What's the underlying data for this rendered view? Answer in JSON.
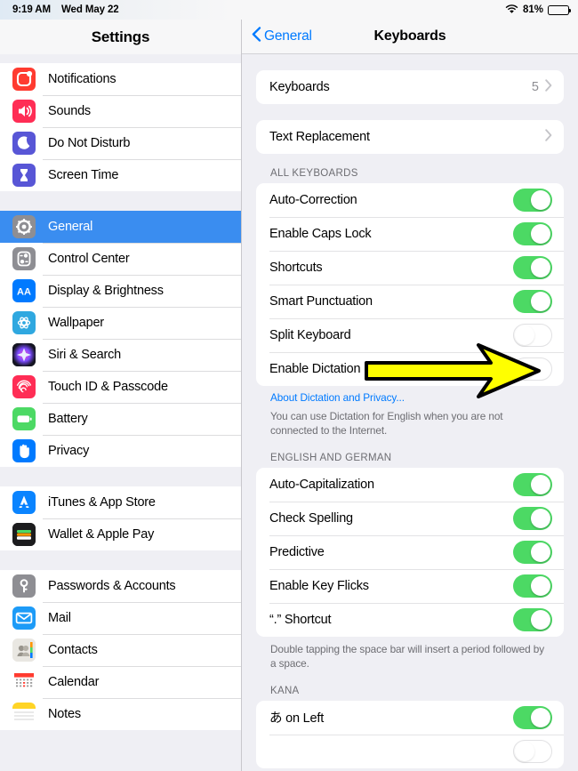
{
  "status_bar": {
    "time": "9:19 AM",
    "date": "Wed May 22",
    "battery_percent": "81%",
    "wifi_icon": "wifi-icon",
    "battery_icon": "battery-icon"
  },
  "sidebar": {
    "title": "Settings",
    "groups": [
      {
        "items": [
          {
            "label": "Notifications",
            "icon": "notifications-icon",
            "selected": false
          },
          {
            "label": "Sounds",
            "icon": "sounds-icon",
            "selected": false
          },
          {
            "label": "Do Not Disturb",
            "icon": "moon-icon",
            "selected": false
          },
          {
            "label": "Screen Time",
            "icon": "hourglass-icon",
            "selected": false
          }
        ]
      },
      {
        "items": [
          {
            "label": "General",
            "icon": "gear-icon",
            "selected": true
          },
          {
            "label": "Control Center",
            "icon": "control-center-icon",
            "selected": false
          },
          {
            "label": "Display & Brightness",
            "icon": "display-brightness-icon",
            "selected": false
          },
          {
            "label": "Wallpaper",
            "icon": "wallpaper-icon",
            "selected": false
          },
          {
            "label": "Siri & Search",
            "icon": "siri-icon",
            "selected": false
          },
          {
            "label": "Touch ID & Passcode",
            "icon": "fingerprint-icon",
            "selected": false
          },
          {
            "label": "Battery",
            "icon": "battery-icon",
            "selected": false
          },
          {
            "label": "Privacy",
            "icon": "hand-icon",
            "selected": false
          }
        ]
      },
      {
        "items": [
          {
            "label": "iTunes & App Store",
            "icon": "app-store-icon",
            "selected": false
          },
          {
            "label": "Wallet & Apple Pay",
            "icon": "wallet-icon",
            "selected": false
          }
        ]
      },
      {
        "items": [
          {
            "label": "Passwords & Accounts",
            "icon": "key-icon",
            "selected": false
          },
          {
            "label": "Mail",
            "icon": "mail-icon",
            "selected": false
          },
          {
            "label": "Contacts",
            "icon": "contacts-icon",
            "selected": false
          },
          {
            "label": "Calendar",
            "icon": "calendar-icon",
            "selected": false
          },
          {
            "label": "Notes",
            "icon": "notes-icon",
            "selected": false
          }
        ]
      }
    ]
  },
  "nav": {
    "back_label": "General",
    "back_icon": "chevron-left-icon",
    "title": "Keyboards"
  },
  "detail": {
    "keyboards_row": {
      "label": "Keyboards",
      "value": "5",
      "disclosure_icon": "chevron-right-icon"
    },
    "text_replacement_row": {
      "label": "Text Replacement",
      "disclosure_icon": "chevron-right-icon"
    },
    "all_keyboards": {
      "header": "ALL KEYBOARDS",
      "rows": [
        {
          "label": "Auto-Correction",
          "state": "on"
        },
        {
          "label": "Enable Caps Lock",
          "state": "on"
        },
        {
          "label": "Shortcuts",
          "state": "on"
        },
        {
          "label": "Smart Punctuation",
          "state": "on"
        },
        {
          "label": "Split Keyboard",
          "state": "off"
        },
        {
          "label": "Enable Dictation",
          "state": "off"
        }
      ],
      "link": "About Dictation and Privacy...",
      "footnote": "You can use Dictation for English when you are not connected to the Internet."
    },
    "english_and_german": {
      "header": "ENGLISH AND GERMAN",
      "rows": [
        {
          "label": "Auto-Capitalization",
          "state": "on"
        },
        {
          "label": "Check Spelling",
          "state": "on"
        },
        {
          "label": "Predictive",
          "state": "on"
        },
        {
          "label": "Enable Key Flicks",
          "state": "on"
        },
        {
          "label": "“.” Shortcut",
          "state": "on"
        }
      ],
      "footnote": "Double tapping the space bar will insert a period followed by a space."
    },
    "kana": {
      "header": "KANA",
      "rows": [
        {
          "label": "あ on Left",
          "state": "on"
        },
        {
          "label": "",
          "state": "off"
        }
      ]
    }
  },
  "annotation": {
    "arrow_icon": "yellow-arrow-annotation",
    "arrow_fill": "#ffff00",
    "arrow_stroke": "#000000",
    "points_at": "Split Keyboard"
  },
  "colors": {
    "accent_blue": "#007aff",
    "selection_blue": "#3a8df0",
    "toggle_green": "#4cd964",
    "background": "#efeff4",
    "card": "#ffffff"
  }
}
